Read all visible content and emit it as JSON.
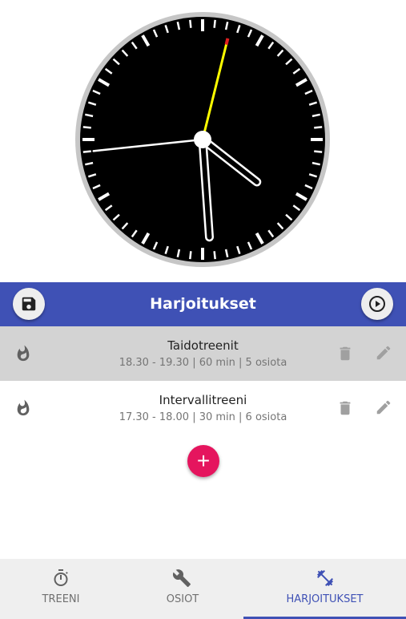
{
  "clock": {
    "time": "16:56:16",
    "hour_hand_angle_deg": 128,
    "minute_hand_angle_deg": 176,
    "second_hand_angle_deg": 14,
    "dial_color": "#000000",
    "rim_color": "#c6c6c6",
    "second_hand_color": "#ffff00"
  },
  "header": {
    "title": "Harjoitukset",
    "background": "#3f51b5",
    "save_icon": "save-icon",
    "play_icon": "play-circle-icon"
  },
  "workouts": [
    {
      "name": "Taidotreenit",
      "details": "18.30 - 19.30 | 60 min | 5 osiota",
      "selected": true
    },
    {
      "name": "Intervallitreeni",
      "details": "17.30 - 18.00 | 30 min | 6 osiota",
      "selected": false
    }
  ],
  "add_button": {
    "label": "+",
    "color": "#e5155e"
  },
  "bottom_nav": {
    "items": [
      {
        "label": "TREENI",
        "icon": "timer-icon",
        "active": false
      },
      {
        "label": "OSIOT",
        "icon": "wrench-icon",
        "active": false
      },
      {
        "label": "HARJOITUKSET",
        "icon": "dumbbell-icon",
        "active": true
      }
    ],
    "active_color": "#3f51b5"
  }
}
